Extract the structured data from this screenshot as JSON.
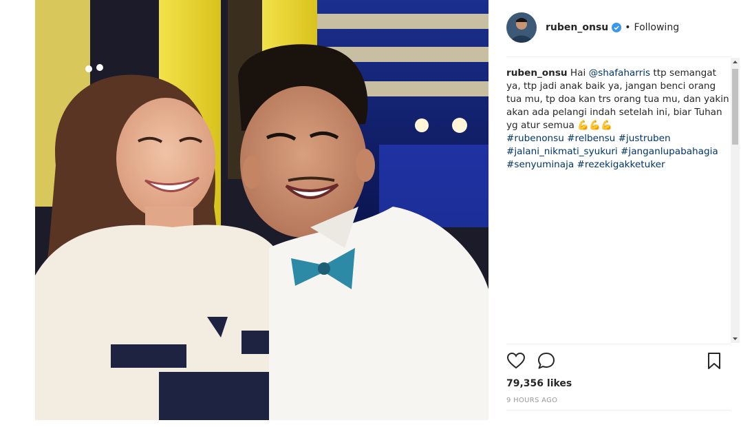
{
  "post": {
    "username": "ruben_onsu",
    "separator": "•",
    "follow_status": "Following"
  },
  "caption": {
    "username": "ruben_onsu",
    "text_1": " Hai ",
    "mention": "@shafaharris",
    "text_2": " ttp semangat ya, ttp jadi anak baik ya, jangan benci orang tua mu, tp doa kan trs orang tua mu, dan yakin akan ada pelangi indah setelah ini, biar Tuhan yg atur semua ",
    "emoji": "💪💪💪",
    "hashtags": [
      "#rubenonsu",
      "#relbensu",
      "#justruben",
      "#jalani_nikmati_syukuri",
      "#janganlupabahagia",
      "#senyuminaja",
      "#rezekigakketuker"
    ]
  },
  "stats": {
    "likes": "79,356 likes",
    "time_ago": "9 HOURS AGO"
  },
  "icons": {
    "like": "heart-icon",
    "comment": "comment-icon",
    "save": "bookmark-icon",
    "verified": "verified-badge-icon"
  },
  "colors": {
    "text": "#262626",
    "link": "#003569",
    "muted": "#999999",
    "verified": "#3897f0"
  }
}
